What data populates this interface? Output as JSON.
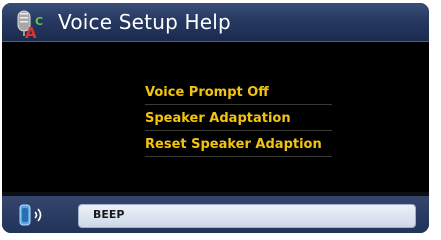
{
  "window": {
    "title": "Voice Setup Help",
    "app_icon": "microphone-abc-icon"
  },
  "menu": {
    "items": [
      {
        "label": "Voice Prompt Off"
      },
      {
        "label": "Speaker Adaptation"
      },
      {
        "label": "Reset Speaker Adaption"
      }
    ]
  },
  "statusbar": {
    "icon": "speaker-voice-icon",
    "text": "BEEP"
  },
  "colors": {
    "title_bar": "#273963",
    "background": "#000000",
    "menu_text": "#f2c410",
    "status_field": "#dfe6f1"
  }
}
